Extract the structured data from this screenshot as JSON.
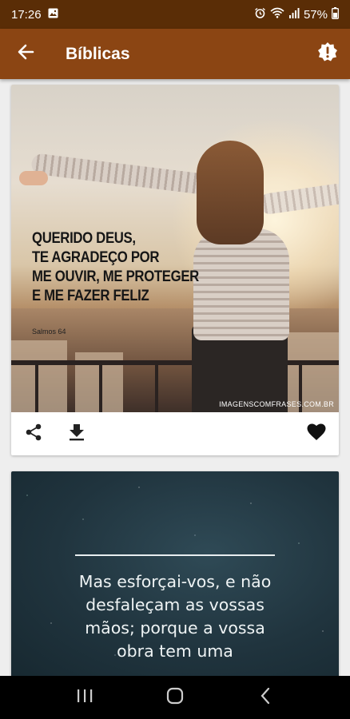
{
  "status_bar": {
    "time": "17:26",
    "battery": "57%",
    "icons": [
      "gallery-icon",
      "alarm-icon",
      "wifi-icon",
      "signal-icon",
      "battery-icon"
    ]
  },
  "app_bar": {
    "title": "Bíblicas",
    "back_icon": "arrow-left-icon",
    "action_icon": "alert-badge-icon",
    "color": "#8b4513"
  },
  "posts": [
    {
      "quote_lines": [
        "QUERIDO DEUS,",
        "TE AGRADEÇO POR",
        "ME OUVIR, ME PROTEGER",
        "E ME FAZER FELIZ"
      ],
      "source": "Salmos 64",
      "watermark": "IMAGENSCOMFRASES.COM.BR",
      "actions": [
        "share-icon",
        "download-icon",
        "heart-icon"
      ],
      "favorited": true
    },
    {
      "quote_lines": [
        "Mas esforçai-vos, e não",
        "desfaleçam as vossas",
        "mãos; porque a vossa",
        "obra tem uma"
      ]
    }
  ],
  "nav_bar": {
    "buttons": [
      "recent-apps-icon",
      "home-icon",
      "back-icon"
    ]
  }
}
